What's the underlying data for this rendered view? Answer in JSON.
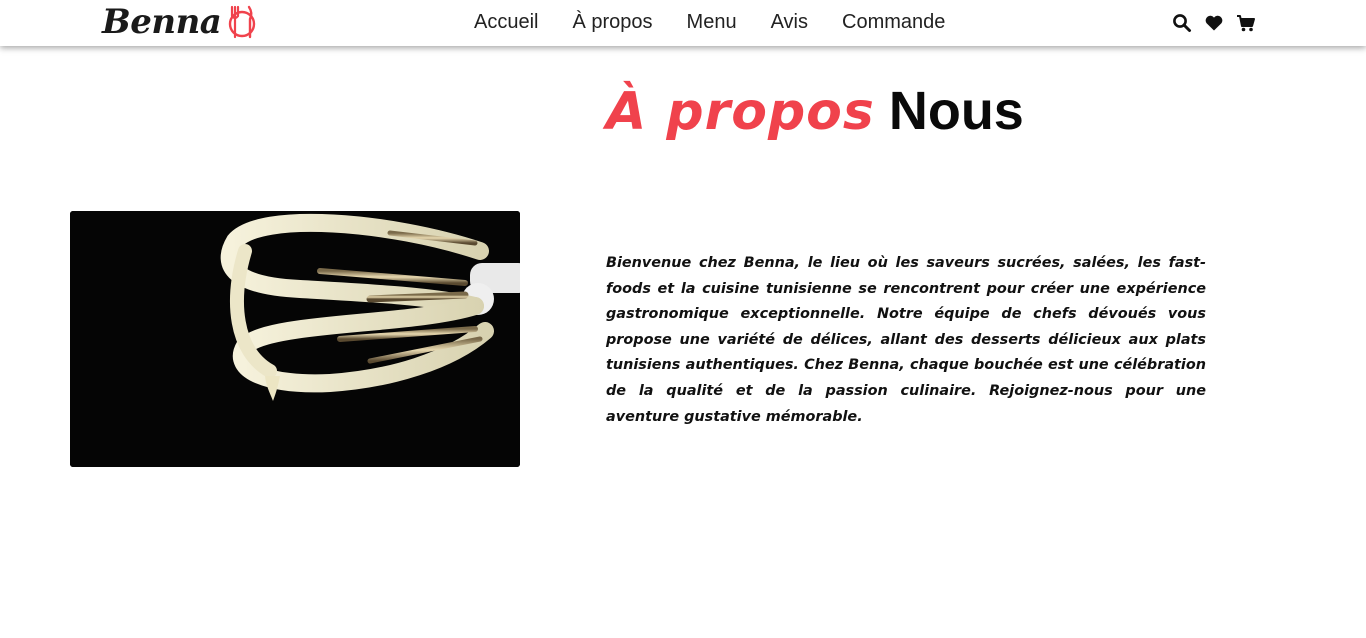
{
  "brand": {
    "name": "Benna",
    "icon": "fork-knife-plate-icon",
    "accent_color": "#f0424c"
  },
  "nav": {
    "links": [
      "Accueil",
      "À propos",
      "Menu",
      "Avis",
      "Commande"
    ],
    "icons": [
      "search-icon",
      "heart-icon",
      "cart-icon"
    ]
  },
  "about": {
    "heading_accent": "À propos",
    "heading_main": "Nous",
    "image_subject": "whisk-with-cream",
    "text": "Bienvenue chez Benna, le lieu où les saveurs sucrées, salées, les fast-foods et la cuisine tunisienne se rencontrent pour créer une expérience gastronomique exceptionnelle. Notre équipe de chefs dévoués vous propose une variété de délices, allant des desserts délicieux aux plats tunisiens authentiques. Chez Benna, chaque bouchée est une célébration de la qualité et de la passion culinaire. Rejoignez-nous pour une aventure gustative mémorable."
  }
}
